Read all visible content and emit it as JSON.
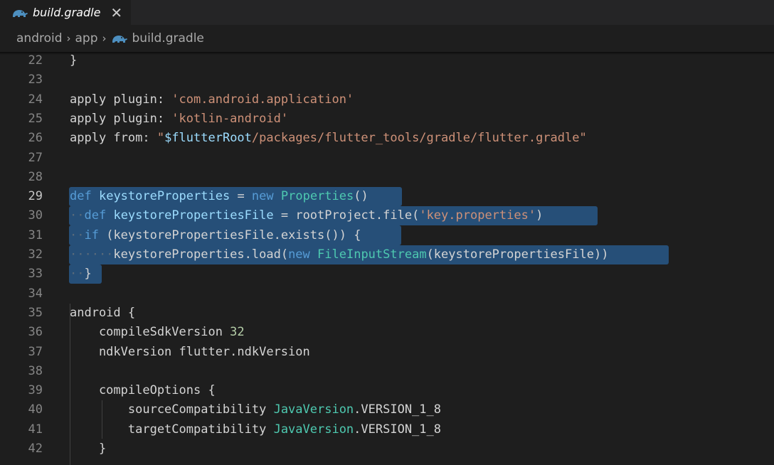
{
  "tab": {
    "title": "build.gradle",
    "close_glyph": "✕",
    "icon": "gradle-elephant-icon"
  },
  "breadcrumb": {
    "items": [
      "android",
      "app",
      "build.gradle"
    ],
    "separator": "›"
  },
  "colors": {
    "keyword": "#569cd6",
    "type": "#4ec9b0",
    "string": "#ce9178",
    "variable": "#9cdcfe",
    "number": "#b5cea8",
    "selection": "#264f78"
  },
  "lines": [
    {
      "n": "22",
      "tokens": [
        {
          "t": "}",
          "c": "plain"
        }
      ]
    },
    {
      "n": "23",
      "tokens": []
    },
    {
      "n": "24",
      "tokens": [
        {
          "t": "apply plugin: ",
          "c": "plain"
        },
        {
          "t": "'com.android.application'",
          "c": "str"
        }
      ]
    },
    {
      "n": "25",
      "tokens": [
        {
          "t": "apply plugin: ",
          "c": "plain"
        },
        {
          "t": "'kotlin-android'",
          "c": "str"
        }
      ]
    },
    {
      "n": "26",
      "tokens": [
        {
          "t": "apply from: ",
          "c": "plain"
        },
        {
          "t": "\"",
          "c": "str"
        },
        {
          "t": "$flutterRoot",
          "c": "var"
        },
        {
          "t": "/packages/flutter_tools/gradle/flutter.gradle\"",
          "c": "str"
        }
      ]
    },
    {
      "n": "27",
      "tokens": []
    },
    {
      "n": "28",
      "tokens": []
    },
    {
      "n": "29",
      "active": true,
      "tokens": [
        {
          "t": "def",
          "c": "kw"
        },
        {
          "t": " ",
          "c": "plain"
        },
        {
          "t": "keystoreProperties",
          "c": "var"
        },
        {
          "t": " = ",
          "c": "plain"
        },
        {
          "t": "new",
          "c": "kw"
        },
        {
          "t": " ",
          "c": "plain"
        },
        {
          "t": "Properties",
          "c": "ty"
        },
        {
          "t": "()",
          "c": "plain"
        }
      ]
    },
    {
      "n": "30",
      "tokens": [
        {
          "t": "··",
          "c": "ws"
        },
        {
          "t": "def",
          "c": "kw"
        },
        {
          "t": " ",
          "c": "plain"
        },
        {
          "t": "keystorePropertiesFile",
          "c": "var"
        },
        {
          "t": " = rootProject.file(",
          "c": "plain"
        },
        {
          "t": "'key.properties'",
          "c": "str"
        },
        {
          "t": ")",
          "c": "plain"
        }
      ]
    },
    {
      "n": "31",
      "tokens": [
        {
          "t": "··",
          "c": "ws"
        },
        {
          "t": "if",
          "c": "kw"
        },
        {
          "t": " (keystorePropertiesFile.exists()) {",
          "c": "plain"
        }
      ]
    },
    {
      "n": "32",
      "tokens": [
        {
          "t": "······",
          "c": "ws"
        },
        {
          "t": "keystoreProperties.load(",
          "c": "plain"
        },
        {
          "t": "new",
          "c": "kw"
        },
        {
          "t": " ",
          "c": "plain"
        },
        {
          "t": "FileInputStream",
          "c": "ty"
        },
        {
          "t": "(keystorePropertiesFile))",
          "c": "plain"
        }
      ]
    },
    {
      "n": "33",
      "tokens": [
        {
          "t": "··",
          "c": "ws"
        },
        {
          "t": "}",
          "c": "plain"
        }
      ]
    },
    {
      "n": "34",
      "tokens": []
    },
    {
      "n": "35",
      "tokens": [
        {
          "t": "android {",
          "c": "plain"
        }
      ]
    },
    {
      "n": "36",
      "tokens": [
        {
          "t": "    compileSdkVersion ",
          "c": "plain"
        },
        {
          "t": "32",
          "c": "num"
        }
      ]
    },
    {
      "n": "37",
      "tokens": [
        {
          "t": "    ndkVersion flutter.ndkVersion",
          "c": "plain"
        }
      ]
    },
    {
      "n": "38",
      "tokens": []
    },
    {
      "n": "39",
      "tokens": [
        {
          "t": "    compileOptions {",
          "c": "plain"
        }
      ]
    },
    {
      "n": "40",
      "tokens": [
        {
          "t": "        sourceCompatibility ",
          "c": "plain"
        },
        {
          "t": "JavaVersion",
          "c": "ty"
        },
        {
          "t": ".VERSION_1_8",
          "c": "plain"
        }
      ]
    },
    {
      "n": "41",
      "tokens": [
        {
          "t": "        targetCompatibility ",
          "c": "plain"
        },
        {
          "t": "JavaVersion",
          "c": "ty"
        },
        {
          "t": ".VERSION_1_8",
          "c": "plain"
        }
      ]
    },
    {
      "n": "42",
      "tokens": [
        {
          "t": "    }",
          "c": "plain"
        }
      ]
    }
  ]
}
